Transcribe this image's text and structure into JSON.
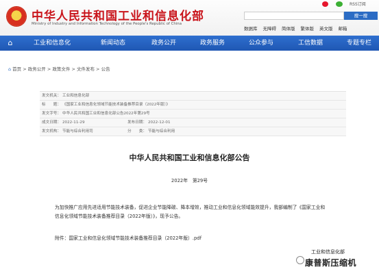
{
  "header": {
    "title": "中华人民共和国工业和信息化部",
    "subtitle": "Ministry of Industry and Information Technology of the People's Republic of China",
    "rss_label": "RSS订阅",
    "search": {
      "placeholder": "",
      "button_label": "搜一搜"
    },
    "quick_links": [
      "数据库",
      "无障碍",
      "简体版",
      "繁体版",
      "英文版",
      "邮箱"
    ],
    "colors": {
      "brand_red": "#c9141b",
      "nav_blue": "#2b6cc4"
    }
  },
  "nav": {
    "home_icon": "home-icon",
    "items": [
      "工业和信息化",
      "新闻动态",
      "政务公开",
      "政务服务",
      "公众参与",
      "工信数据",
      "专题专栏"
    ]
  },
  "breadcrumb": {
    "items": [
      "首页",
      "政务公开",
      "政策文件",
      "文件发布",
      "公告"
    ],
    "separator": ">"
  },
  "meta": {
    "issuer_label": "发文机关：",
    "issuer_value": "工业和信息化部",
    "title_label": "标　　题：",
    "title_value": "《国家工业和信息化领域节能技术装备推荐目录（2022年版）》",
    "docno_label": "发文字号：",
    "docno_value": "中华人民共和国工业和信息化部公告2022年第29号",
    "created_label": "成文日期：",
    "created_value": "2022-11-29",
    "published_label": "发布日期：",
    "published_value": "2022-12-01",
    "category_label": "发文机构：",
    "category_value": "节能与综合利用司",
    "topic_label": "分　　类：",
    "topic_value": "节能与综合利用"
  },
  "document": {
    "title": "中华人民共和国工业和信息化部公告",
    "number": "2022年　第29号",
    "paragraph": "为加快推广应用先进适用节能技术装备，促进企业节能降碳、降本增效，推动工业和信息化领域能效提升，我部编制了《国家工业和信息化领域节能技术装备推荐目录（2022年版）》，现予公告。",
    "attachment": "附件：国家工业和信息化领域节能技术装备推荐目录（2022年版）.pdf"
  },
  "watermark": {
    "line1": "工业和信息化部",
    "line2": "康普斯压缩机"
  }
}
